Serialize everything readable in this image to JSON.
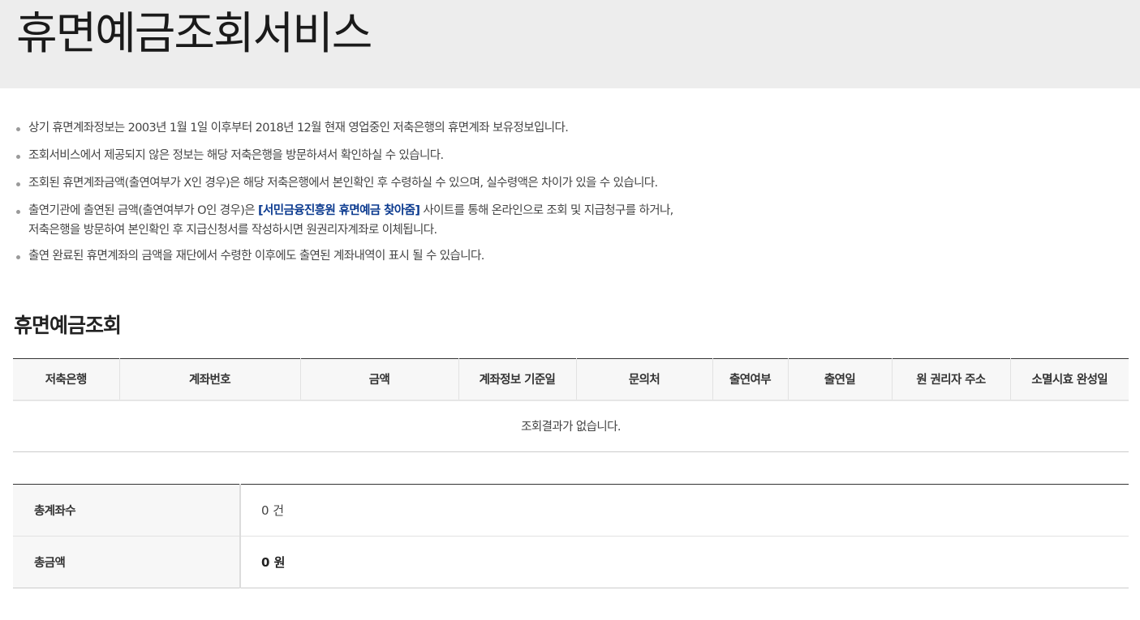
{
  "page": {
    "title": "휴면예금조회서비스"
  },
  "notes": {
    "n1": "상기 휴면계좌정보는 2003년 1월 1일 이후부터 2018년 12월 현재 영업중인 저축은행의 휴면계좌 보유정보입니다.",
    "n2": "조회서비스에서 제공되지 않은 정보는 해당 저축은행을 방문하셔서 확인하실 수 있습니다.",
    "n3": "조회된 휴면계좌금액(출연여부가 X인 경우)은 해당 저축은행에서 본인확인 후 수령하실 수 있으며, 실수령액은 차이가 있을 수 있습니다.",
    "n4_before": "출연기관에 출연된 금액(출연여부가 O인 경우)은 ",
    "n4_link": "[서민금융진흥원 휴면예금 찾아줌]",
    "n4_after": " 사이트를 통해 온라인으로 조회 및 지급청구를 하거나,",
    "n4_line2": "저축은행을 방문하여 본인확인 후 지급신청서를 작성하시면 원권리자계좌로 이체됩니다.",
    "n5": "출연 완료된 휴면계좌의 금액을 재단에서 수령한 이후에도 출연된 계좌내역이 표시 될 수 있습니다."
  },
  "section": {
    "title": "휴면예금조회"
  },
  "results": {
    "columns": [
      "저축은행",
      "계좌번호",
      "금액",
      "계좌정보 기준일",
      "문의처",
      "출연여부",
      "출연일",
      "원 권리자 주소",
      "소멸시효 완성일"
    ],
    "empty_message": "조회결과가 없습니다."
  },
  "summary": {
    "count_label": "총계좌수",
    "count_value": "0 건",
    "amount_label": "총금액",
    "amount_value": "0 원"
  },
  "colors": {
    "header_bg": "#ededed",
    "link": "#0b3a8f"
  }
}
